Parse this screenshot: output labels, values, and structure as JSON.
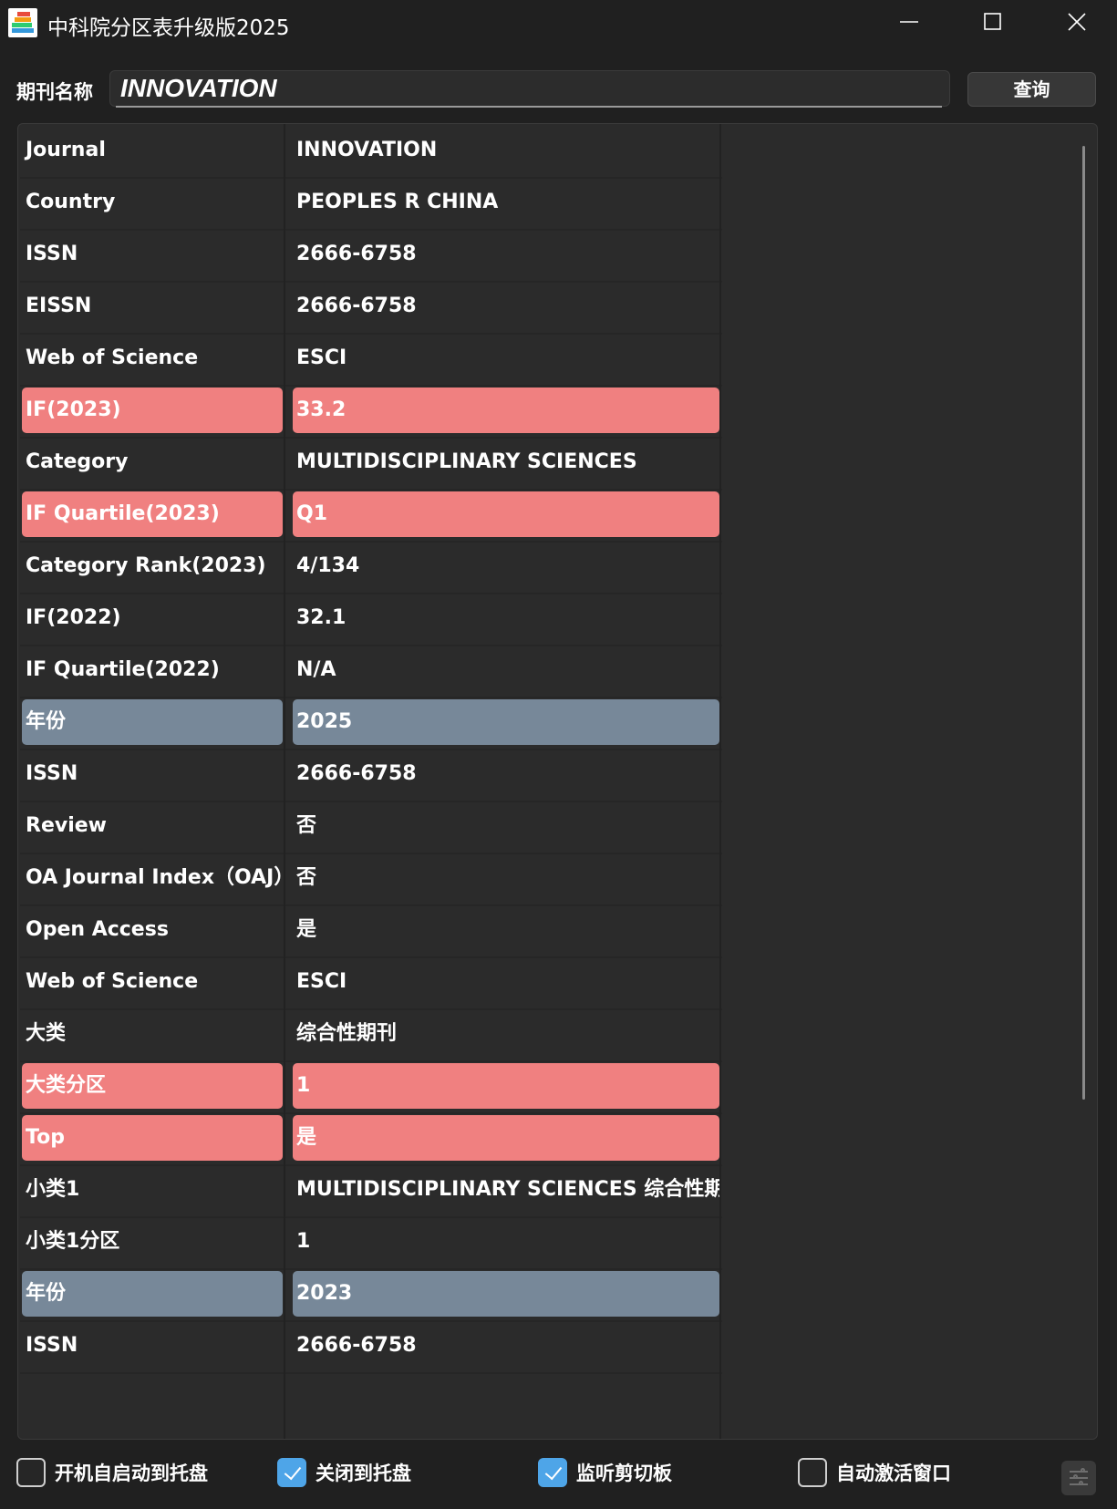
{
  "window": {
    "title": "中科院分区表升级版2025",
    "controls": [
      "minimize",
      "maximize",
      "close"
    ]
  },
  "search": {
    "label": "期刊名称",
    "value": "INNOVATION",
    "button_label": "查询"
  },
  "table": {
    "rows": [
      {
        "key": "Journal",
        "value": "INNOVATION",
        "highlight": "none"
      },
      {
        "key": "Country",
        "value": "PEOPLES R CHINA",
        "highlight": "none"
      },
      {
        "key": "ISSN",
        "value": "2666-6758",
        "highlight": "none"
      },
      {
        "key": "EISSN",
        "value": "2666-6758",
        "highlight": "none"
      },
      {
        "key": "Web of Science",
        "value": "ESCI",
        "highlight": "none"
      },
      {
        "key": "IF(2023)",
        "value": "33.2",
        "highlight": "red"
      },
      {
        "key": "Category",
        "value": "MULTIDISCIPLINARY SCIENCES",
        "highlight": "none"
      },
      {
        "key": "IF Quartile(2023)",
        "value": "Q1",
        "highlight": "red"
      },
      {
        "key": "Category Rank(2023)",
        "value": "4/134",
        "highlight": "none"
      },
      {
        "key": "IF(2022)",
        "value": "32.1",
        "highlight": "none"
      },
      {
        "key": "IF Quartile(2022)",
        "value": "N/A",
        "highlight": "none"
      },
      {
        "key": "年份",
        "value": "2025",
        "highlight": "gray"
      },
      {
        "key": "ISSN",
        "value": "2666-6758",
        "highlight": "none"
      },
      {
        "key": "Review",
        "value": "否",
        "highlight": "none"
      },
      {
        "key": "OA Journal Index（OAJ）",
        "value": "否",
        "highlight": "none"
      },
      {
        "key": "Open Access",
        "value": "是",
        "highlight": "none"
      },
      {
        "key": "Web of Science",
        "value": "ESCI",
        "highlight": "none"
      },
      {
        "key": "大类",
        "value": "综合性期刊",
        "highlight": "none"
      },
      {
        "key": "大类分区",
        "value": "1",
        "highlight": "red"
      },
      {
        "key": "Top",
        "value": "是",
        "highlight": "red"
      },
      {
        "key": "小类1",
        "value": "MULTIDISCIPLINARY SCIENCES 综合性期刊",
        "highlight": "none"
      },
      {
        "key": "小类1分区",
        "value": "1",
        "highlight": "none"
      },
      {
        "key": "年份",
        "value": "2023",
        "highlight": "gray"
      },
      {
        "key": "ISSN",
        "value": "2666-6758",
        "highlight": "none"
      }
    ]
  },
  "options": [
    {
      "label": "开机自启动到托盘",
      "checked": false
    },
    {
      "label": "关闭到托盘",
      "checked": true
    },
    {
      "label": "监听剪切板",
      "checked": true
    },
    {
      "label": "自动激活窗口",
      "checked": false
    }
  ],
  "colors": {
    "highlight_red": "#f08080",
    "highlight_gray": "#778899",
    "checkbox_on": "#4ea5e8",
    "background": "#202020"
  },
  "icons": {
    "app": "app-logo-icon",
    "settings": "settings-sliders-icon"
  }
}
